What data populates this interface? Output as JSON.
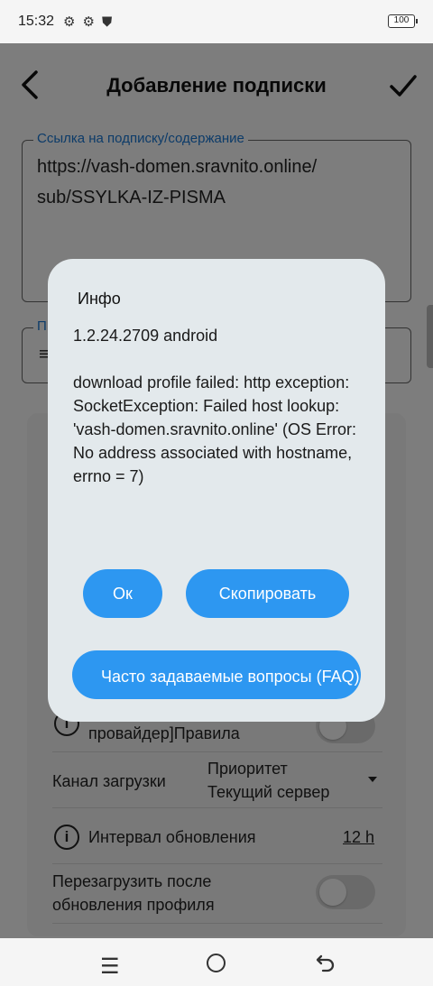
{
  "status_bar": {
    "time": "15:32",
    "battery": "100"
  },
  "app_bar": {
    "title": "Добавление подписки"
  },
  "subscription_field": {
    "label": "Ссылка на подписку/содержание",
    "value": "https://vash-domen.sravnito.online/\nsub/SSYLKA-IZ-PISMA"
  },
  "second_field": {
    "label": "П",
    "icon": "menu-icon"
  },
  "settings": {
    "rule_row_text": "провайдер]Правила",
    "download_channel_label": "Канал загрузки",
    "download_channel_value": "Приоритет\nТекущий сервер",
    "update_interval_label": "Интервал обновления",
    "update_interval_value": "12 h",
    "reload_after_update_label": "Перезагрузить после\nобновления профиля"
  },
  "dialog": {
    "title": "Инфо",
    "body": "1.2.24.2709 android\n\ndownload profile failed: http exception: SocketException: Failed host lookup: 'vash-domen.sravnito.online' (OS Error: No address associated with hostname, errno = 7)",
    "ok_label": "Ок",
    "copy_label": "Скопировать",
    "faq_label": "Часто задаваемые вопросы (FAQ)"
  },
  "colors": {
    "accent": "#2d97f1",
    "label_blue": "#1976d2",
    "dialog_bg": "#e3e9ec"
  }
}
